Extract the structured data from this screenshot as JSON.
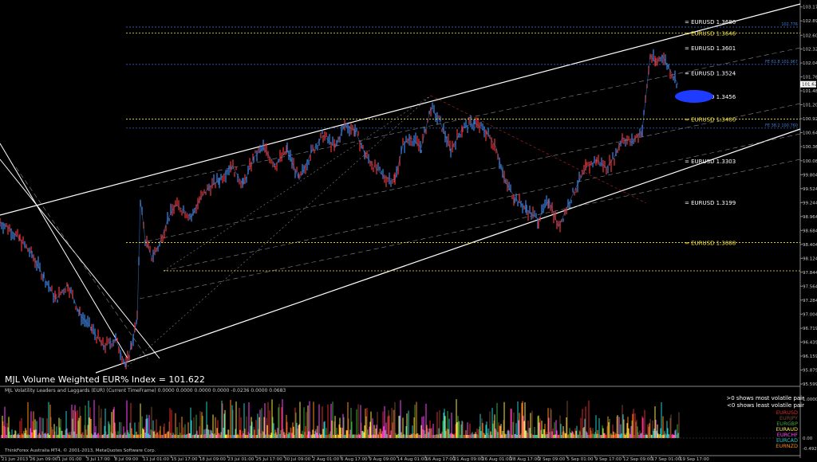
{
  "chart_data": {
    "type": "line",
    "title": "MJL Volume Weighted EUR% Index = 101.622",
    "main": {
      "ylim": [
        95.6,
        103.25
      ],
      "y_ticks": [
        "103.174",
        "102.894",
        "102.605",
        "102.329",
        "102.049",
        "101.769",
        "101.489",
        "101.209",
        "100.929",
        "100.649",
        "100.369",
        "100.084",
        "99.804",
        "99.524",
        "99.244",
        "98.964",
        "98.684",
        "98.404",
        "98.124",
        "97.844",
        "97.564",
        "97.284",
        "97.004",
        "96.719",
        "96.439",
        "96.159",
        "95.879",
        "95.599"
      ],
      "current_price": "101.622",
      "series_points": [
        [
          0,
          98.85
        ],
        [
          12,
          98.72
        ],
        [
          25,
          98.5
        ],
        [
          40,
          98.2
        ],
        [
          55,
          97.75
        ],
        [
          70,
          97.3
        ],
        [
          85,
          97.6
        ],
        [
          100,
          97.0
        ],
        [
          115,
          96.7
        ],
        [
          130,
          96.35
        ],
        [
          145,
          96.5
        ],
        [
          158,
          95.95
        ],
        [
          165,
          96.4
        ],
        [
          172,
          96.9
        ],
        [
          176,
          99.3
        ],
        [
          182,
          98.5
        ],
        [
          190,
          98.15
        ],
        [
          200,
          98.4
        ],
        [
          210,
          98.9
        ],
        [
          220,
          99.2
        ],
        [
          230,
          99.1
        ],
        [
          240,
          98.95
        ],
        [
          250,
          99.3
        ],
        [
          262,
          99.55
        ],
        [
          275,
          99.7
        ],
        [
          290,
          100.0
        ],
        [
          305,
          99.6
        ],
        [
          318,
          100.15
        ],
        [
          330,
          100.35
        ],
        [
          345,
          100.0
        ],
        [
          360,
          100.3
        ],
        [
          375,
          99.7
        ],
        [
          390,
          100.25
        ],
        [
          405,
          100.6
        ],
        [
          420,
          100.35
        ],
        [
          432,
          100.8
        ],
        [
          445,
          100.7
        ],
        [
          458,
          100.2
        ],
        [
          470,
          99.95
        ],
        [
          482,
          99.75
        ],
        [
          495,
          99.7
        ],
        [
          505,
          100.4
        ],
        [
          515,
          100.55
        ],
        [
          528,
          100.35
        ],
        [
          540,
          101.15
        ],
        [
          552,
          100.85
        ],
        [
          565,
          100.3
        ],
        [
          580,
          100.75
        ],
        [
          595,
          100.85
        ],
        [
          610,
          100.65
        ],
        [
          622,
          100.35
        ],
        [
          632,
          99.7
        ],
        [
          645,
          99.35
        ],
        [
          660,
          99.1
        ],
        [
          675,
          98.9
        ],
        [
          688,
          99.3
        ],
        [
          700,
          98.75
        ],
        [
          712,
          99.2
        ],
        [
          722,
          99.55
        ],
        [
          735,
          99.95
        ],
        [
          748,
          100.1
        ],
        [
          760,
          99.95
        ],
        [
          770,
          100.15
        ],
        [
          780,
          100.55
        ],
        [
          792,
          100.45
        ],
        [
          805,
          100.7
        ],
        [
          815,
          102.2
        ],
        [
          822,
          102.05
        ],
        [
          830,
          102.2
        ],
        [
          840,
          101.9
        ],
        [
          850,
          101.62
        ]
      ],
      "horizontal_levels": [
        {
          "label": "EURUSD  1.3680",
          "value": 102.88,
          "color": "#ffffff"
        },
        {
          "label": "EURUSD  1.3646",
          "value": 102.65,
          "color": "#f5e642"
        },
        {
          "label": "EURUSD  1.3601",
          "value": 102.35,
          "color": "#ffffff"
        },
        {
          "label": "EURUSD  1.3524",
          "value": 101.85,
          "color": "#ffffff"
        },
        {
          "label": "EURUSD  1.3456",
          "value": 101.38,
          "color": "#ffffff"
        },
        {
          "label": "EURUSD  1.3400",
          "value": 100.92,
          "color": "#f5e642"
        },
        {
          "label": "EURUSD  1.3303",
          "value": 100.08,
          "color": "#ffffff"
        },
        {
          "label": "EURUSD  1.3199",
          "value": 99.25,
          "color": "#ffffff"
        },
        {
          "label": "EURUSD  1.3088",
          "value": 98.44,
          "color": "#f5e642"
        }
      ],
      "fib_labels": [
        {
          "text": "102.776",
          "value": 102.77
        },
        {
          "text": "FE  61.8     101.967",
          "value": 102.02
        },
        {
          "text": "FE  38.2     100.760",
          "value": 100.74
        }
      ]
    },
    "indicator": {
      "title": "MJL Volatility Leaders and Laggards (EUR) (Current TimeFrame) 0.0000 0.0000 0.0000 0.0000 -0.0236 0.0000 0.0683",
      "note1": ">0 shows most volatile pair",
      "note2": "<0 shows least volatile pair",
      "y_ticks": [
        "1.0000",
        "0.00",
        "-0.4928"
      ],
      "legend": [
        {
          "name": "EURUSD",
          "color": "#e02a2a"
        },
        {
          "name": "EURJPY",
          "color": "#7a4a2a"
        },
        {
          "name": "EURGBP",
          "color": "#3aa83a"
        },
        {
          "name": "EURAUD",
          "color": "#f5e642"
        },
        {
          "name": "EURCHF",
          "color": "#ff44ff"
        },
        {
          "name": "EURCAD",
          "color": "#22cccc"
        },
        {
          "name": "EURNZD",
          "color": "#ff8c1a"
        }
      ]
    },
    "x_labels": [
      "21 Jun 2013",
      "26 Jun 09:00",
      "1 Jul 01:00",
      "3 Jul 17:00",
      "8 Jul 09:00",
      "11 Jul 01:00",
      "15 Jul 17:00",
      "18 Jul 09:00",
      "23 Jul 01:00",
      "25 Jul 17:00",
      "30 Jul 09:00",
      "2 Aug 01:00",
      "6 Aug 17:00",
      "9 Aug 09:00",
      "14 Aug 01:00",
      "16 Aug 17:00",
      "21 Aug 09:00",
      "26 Aug 01:00",
      "28 Aug 17:00",
      "2 Sep 09:00",
      "5 Sep 01:00",
      "9 Sep 17:00",
      "12 Sep 09:00",
      "17 Sep 01:00",
      "19 Sep 17:00"
    ],
    "copyright": "ThinkForex Australia MT4, © 2001-2013, MetaQuotes Software Corp."
  },
  "colors": {
    "candle_up": "#3a7bd5",
    "candle_down": "#e03030",
    "grid": "#1a1a1a"
  }
}
